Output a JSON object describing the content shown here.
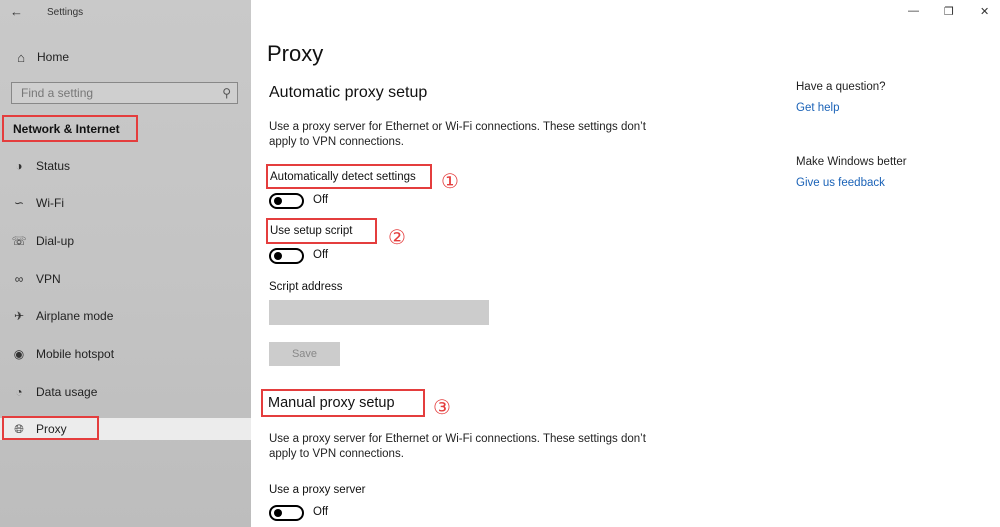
{
  "window": {
    "title": "Settings",
    "back_icon": "arrow-left-icon",
    "controls": {
      "minimize": "—",
      "maximize": "❐",
      "close": "✕"
    }
  },
  "sidebar": {
    "home": {
      "label": "Home",
      "icon": "home-icon"
    },
    "search": {
      "placeholder": "Find a setting",
      "icon": "search-icon"
    },
    "section_title": "Network & Internet",
    "items": [
      {
        "label": "Status",
        "icon": "globe-status-icon"
      },
      {
        "label": "Wi-Fi",
        "icon": "wifi-icon"
      },
      {
        "label": "Dial-up",
        "icon": "phone-icon"
      },
      {
        "label": "VPN",
        "icon": "vpn-icon"
      },
      {
        "label": "Airplane mode",
        "icon": "airplane-icon"
      },
      {
        "label": "Mobile hotspot",
        "icon": "hotspot-icon"
      },
      {
        "label": "Data usage",
        "icon": "data-usage-icon"
      },
      {
        "label": "Proxy",
        "icon": "globe-icon",
        "active": true
      }
    ]
  },
  "main": {
    "title": "Proxy",
    "automatic": {
      "heading": "Automatic proxy setup",
      "description": "Use a proxy server for Ethernet or Wi-Fi connections. These settings don’t apply to VPN connections.",
      "auto_detect": {
        "label": "Automatically detect settings",
        "state": "Off",
        "marker": "①"
      },
      "setup_script": {
        "label": "Use setup script",
        "state": "Off",
        "marker": "②"
      },
      "script_address": {
        "label": "Script address",
        "value": ""
      },
      "save_label": "Save"
    },
    "manual": {
      "heading": "Manual proxy setup",
      "marker": "③",
      "description": "Use a proxy server for Ethernet or Wi-Fi connections. These settings don’t apply to VPN connections.",
      "use_proxy": {
        "label": "Use a proxy server",
        "state": "Off"
      }
    }
  },
  "right_panel": {
    "question_title": "Have a question?",
    "get_help": "Get help",
    "better_title": "Make Windows better",
    "feedback": "Give us feedback"
  },
  "colors": {
    "annotation_red": "#e43d3d",
    "link_blue": "#1a62b7",
    "sidebar_bg": "#c4c4c4"
  }
}
